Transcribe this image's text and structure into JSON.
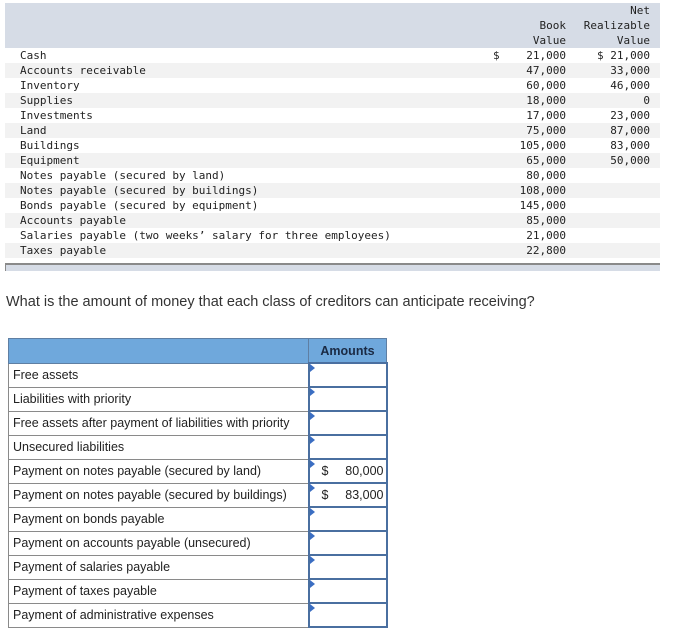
{
  "data_table": {
    "headers": {
      "book_value_line1": "Book",
      "book_value_line2": "Value",
      "nrv_line1": "Net",
      "nrv_line2": "Realizable",
      "nrv_line3": "Value"
    },
    "rows": [
      {
        "label": "Cash",
        "book_dollar": "$",
        "book_value": "21,000",
        "nrv": "$ 21,000"
      },
      {
        "label": "Accounts receivable",
        "book_dollar": "",
        "book_value": "47,000",
        "nrv": "33,000"
      },
      {
        "label": "Inventory",
        "book_dollar": "",
        "book_value": "60,000",
        "nrv": "46,000"
      },
      {
        "label": "Supplies",
        "book_dollar": "",
        "book_value": "18,000",
        "nrv": "0"
      },
      {
        "label": "Investments",
        "book_dollar": "",
        "book_value": "17,000",
        "nrv": "23,000"
      },
      {
        "label": "Land",
        "book_dollar": "",
        "book_value": "75,000",
        "nrv": "87,000"
      },
      {
        "label": "Buildings",
        "book_dollar": "",
        "book_value": "105,000",
        "nrv": "83,000"
      },
      {
        "label": "Equipment",
        "book_dollar": "",
        "book_value": "65,000",
        "nrv": "50,000"
      },
      {
        "label": "Notes payable (secured by land)",
        "book_dollar": "",
        "book_value": "80,000",
        "nrv": ""
      },
      {
        "label": "Notes payable (secured by buildings)",
        "book_dollar": "",
        "book_value": "108,000",
        "nrv": ""
      },
      {
        "label": "Bonds payable (secured by equipment)",
        "book_dollar": "",
        "book_value": "145,000",
        "nrv": ""
      },
      {
        "label": "Accounts payable",
        "book_dollar": "",
        "book_value": "85,000",
        "nrv": ""
      },
      {
        "label": "Salaries payable (two weeks’ salary for three employees)",
        "book_dollar": "",
        "book_value": "21,000",
        "nrv": ""
      },
      {
        "label": "Taxes payable",
        "book_dollar": "",
        "book_value": "22,800",
        "nrv": ""
      }
    ]
  },
  "question": "What is the amount of money that each class of creditors can anticipate receiving?",
  "answer_table": {
    "header_amounts": "Amounts",
    "rows": [
      {
        "label": "Free assets",
        "dollar": "",
        "value": ""
      },
      {
        "label": "Liabilities with priority",
        "dollar": "",
        "value": ""
      },
      {
        "label": "Free assets after payment of liabilities with priority",
        "dollar": "",
        "value": ""
      },
      {
        "label": "Unsecured liabilities",
        "dollar": "",
        "value": ""
      },
      {
        "label": "Payment on notes payable (secured by land)",
        "dollar": "$",
        "value": "80,000"
      },
      {
        "label": "Payment on notes payable (secured by buildings)",
        "dollar": "$",
        "value": "83,000"
      },
      {
        "label": "Payment on bonds payable",
        "dollar": "",
        "value": ""
      },
      {
        "label": "Payment on accounts payable (unsecured)",
        "dollar": "",
        "value": ""
      },
      {
        "label": "Payment of salaries payable",
        "dollar": "",
        "value": ""
      },
      {
        "label": "Payment of taxes payable",
        "dollar": "",
        "value": ""
      },
      {
        "label": "Payment of administrative expenses",
        "dollar": "",
        "value": ""
      }
    ]
  }
}
